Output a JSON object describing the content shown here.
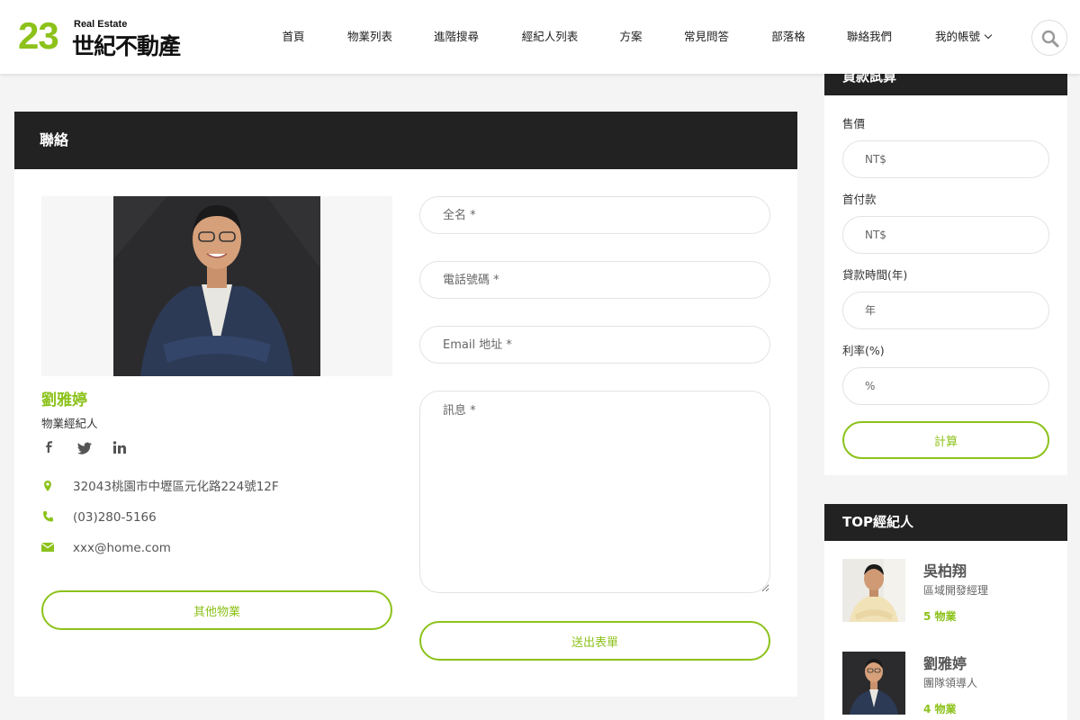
{
  "brand": {
    "number": "23",
    "english": "Real Estate",
    "chinese": "世紀不動產",
    "accent": "#8cc21a",
    "dark": "#222222"
  },
  "nav": {
    "items": [
      {
        "label": "首頁"
      },
      {
        "label": "物業列表"
      },
      {
        "label": "進階搜尋"
      },
      {
        "label": "經紀人列表"
      },
      {
        "label": "方案"
      },
      {
        "label": "常見問答"
      },
      {
        "label": "部落格"
      },
      {
        "label": "聯絡我們"
      },
      {
        "label": "我的帳號"
      }
    ],
    "search_icon": "search-icon"
  },
  "contact": {
    "title": "聯絡",
    "agent": {
      "name": "劉雅婷",
      "role": "物業經紀人",
      "address": "32043桃園市中壢區元化路224號12F",
      "phone": "(03)280-5166",
      "email": "xxx@home.com"
    },
    "socials": [
      "facebook-icon",
      "twitter-icon",
      "linkedin-icon"
    ],
    "other_button": "其他物業",
    "form": {
      "name_placeholder": "全名 *",
      "phone_placeholder": "電話號碼 *",
      "email_placeholder": "Email 地址 *",
      "message_placeholder": "訊息 *",
      "submit_label": "送出表單"
    }
  },
  "calculator": {
    "title": "貸款試算",
    "price_label": "售價",
    "price_placeholder": "NT$",
    "down_label": "首付款",
    "down_placeholder": "NT$",
    "term_label": "貸款時間(年)",
    "term_placeholder": "年",
    "rate_label": "利率(%)",
    "rate_placeholder": "%",
    "calc_button": "計算"
  },
  "top_agents": {
    "title": "TOP經紀人",
    "items": [
      {
        "name": "吳柏翔",
        "role": "區域開發經理",
        "count": "5 物業"
      },
      {
        "name": "劉雅婷",
        "role": "團隊領導人",
        "count": "4 物業"
      }
    ]
  }
}
